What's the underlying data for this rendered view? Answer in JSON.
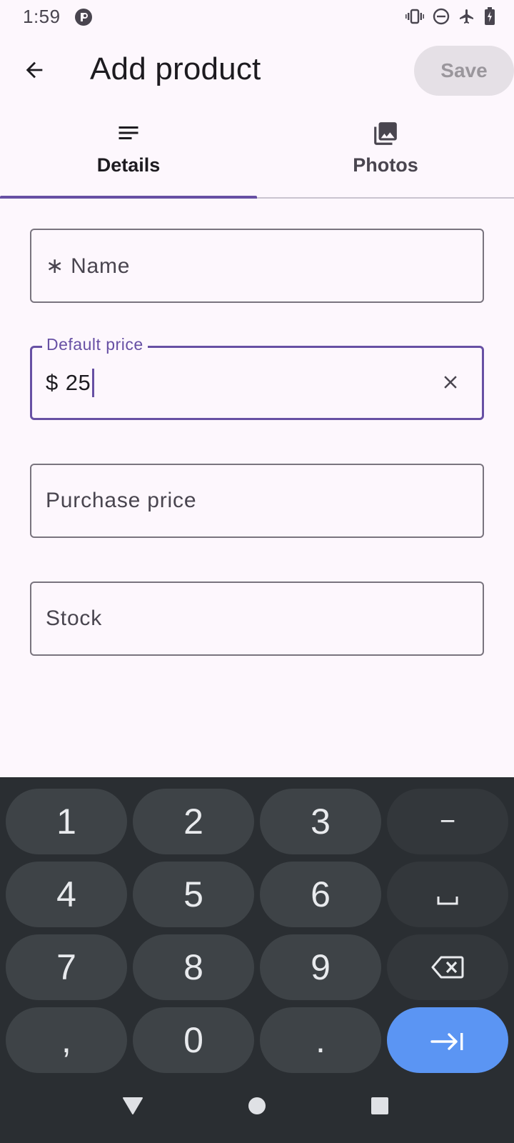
{
  "status_bar": {
    "time": "1:59",
    "icons": [
      "vibrate-icon",
      "do-not-disturb-icon",
      "airplane-mode-icon",
      "battery-charging-icon"
    ]
  },
  "app_bar": {
    "title": "Add product",
    "save_label": "Save"
  },
  "tabs": [
    {
      "label": "Details",
      "icon": "notes-icon",
      "selected": true
    },
    {
      "label": "Photos",
      "icon": "photo-library-icon",
      "selected": false
    }
  ],
  "form": {
    "name": {
      "label": "∗ Name",
      "value": ""
    },
    "default_price": {
      "label": "Default price",
      "prefix": "$",
      "value": "25"
    },
    "purchase_price": {
      "label": "Purchase price",
      "value": ""
    },
    "stock": {
      "label": "Stock",
      "value": ""
    }
  },
  "keyboard": {
    "rows": [
      [
        "1",
        "2",
        "3",
        "−"
      ],
      [
        "4",
        "5",
        "6",
        "␣"
      ],
      [
        "7",
        "8",
        "9",
        "⌫"
      ],
      [
        ",",
        "0",
        ".",
        "⇥"
      ]
    ]
  },
  "colors": {
    "accent": "#6750a4",
    "background": "#fdf7fd",
    "keyboard_bg": "#2a2e32",
    "key": "#3e4347",
    "enter_key": "#5b95f3"
  }
}
